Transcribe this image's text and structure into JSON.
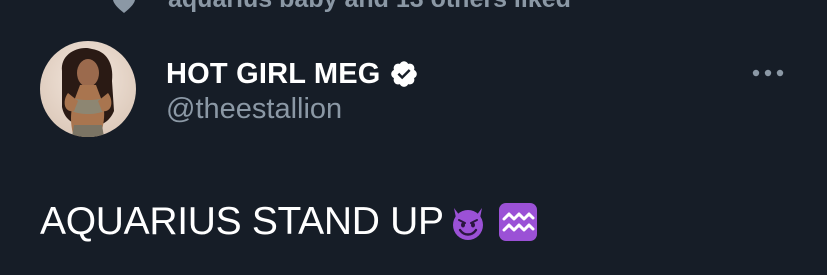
{
  "social_context": {
    "icon": "heart-icon",
    "text": "aquarius baby and 13 others liked"
  },
  "tweet": {
    "author": {
      "display_name": "HOT GIRL MEG",
      "handle": "@theestallion",
      "verified": true,
      "verified_icon": "verified-badge-icon",
      "avatar": "profile-avatar"
    },
    "more_icon": "more-options-icon",
    "text": "AQUARIUS STAND UP",
    "emojis": [
      "smiling-devil-emoji",
      "aquarius-sign-emoji"
    ]
  },
  "colors": {
    "background": "#161d27",
    "primary_text": "#ffffff",
    "secondary_text": "#8b98a5",
    "emoji_purple": "#9b51d6"
  }
}
